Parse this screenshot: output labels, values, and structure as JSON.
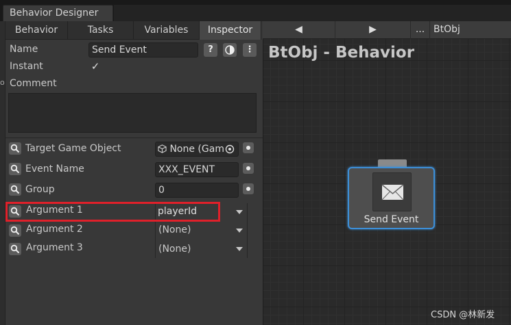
{
  "window": {
    "tab_title": "Behavior Designer"
  },
  "tabs": [
    {
      "label": "Behavior",
      "active": false
    },
    {
      "label": "Tasks",
      "active": false
    },
    {
      "label": "Variables",
      "active": false
    },
    {
      "label": "Inspector",
      "active": true
    }
  ],
  "inspector": {
    "name_label": "Name",
    "name_value": "Send Event",
    "help_icon": "question-icon",
    "instant_label": "Instant",
    "instant_checked": true,
    "comment_label": "Comment",
    "comment_value": "",
    "fields": [
      {
        "label": "Target Game Object",
        "value": "None (Gam"
      },
      {
        "label": "Event Name",
        "value": "XXX_EVENT"
      },
      {
        "label": "Group",
        "value": "0"
      }
    ],
    "arguments": [
      {
        "label": "Argument 1",
        "value": "playerId",
        "highlighted": true
      },
      {
        "label": "Argument 2",
        "value": "(None)",
        "highlighted": false
      },
      {
        "label": "Argument 3",
        "value": "(None)",
        "highlighted": false
      }
    ]
  },
  "graph": {
    "toolbar": {
      "back": "◀",
      "forward": "▶",
      "more": "...",
      "object": "BtObj"
    },
    "title": "BtObj - Behavior",
    "node": {
      "label": "Send Event",
      "icon": "envelope-icon",
      "selected": true
    }
  },
  "watermark": "CSDN @林新发",
  "colors": {
    "highlight_box": "#e0202a",
    "node_selection": "#3d8fd8"
  }
}
